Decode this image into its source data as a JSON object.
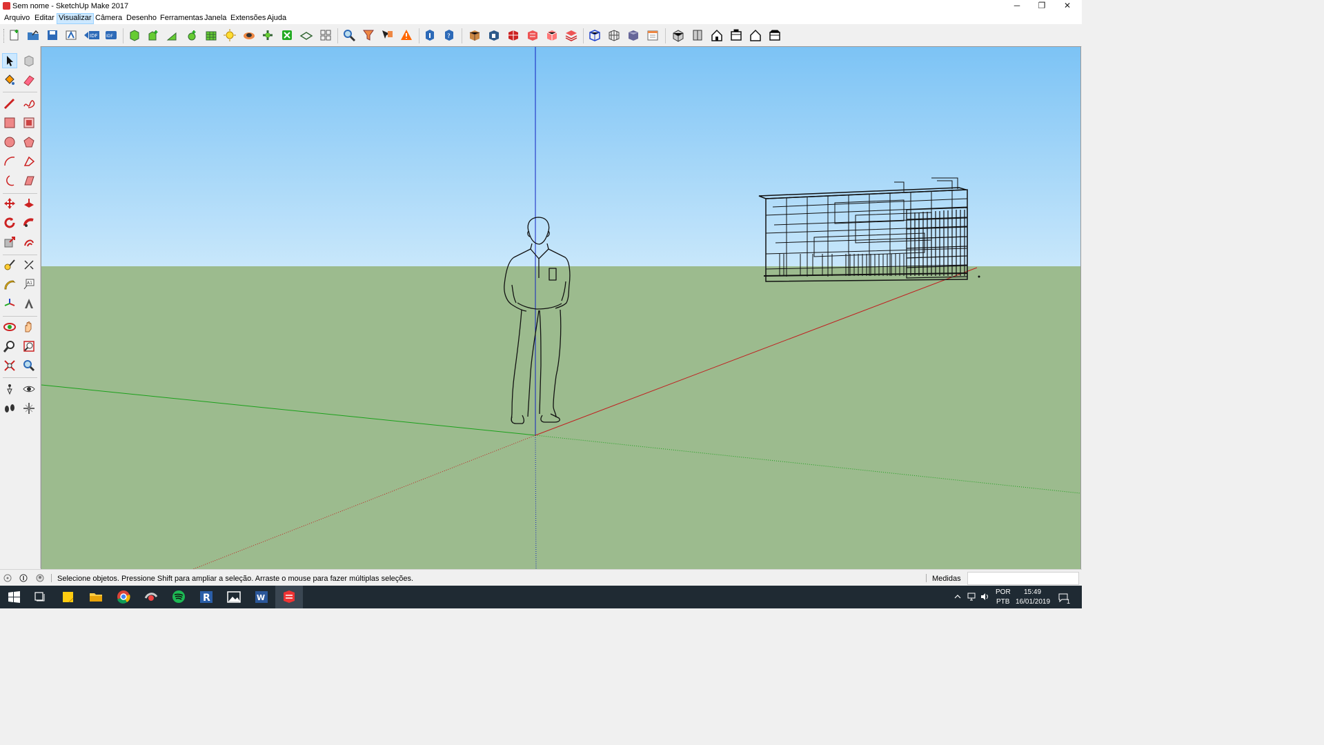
{
  "window": {
    "title": "Sem nome - SketchUp Make 2017",
    "minimize_glyph": "─",
    "restore_glyph": "❐",
    "close_glyph": "✕"
  },
  "menu": {
    "items": [
      "Arquivo",
      "Editar",
      "Visualizar",
      "Câmera",
      "Desenho",
      "Ferramentas",
      "Janela",
      "Extensões",
      "Ajuda"
    ],
    "active": "Visualizar"
  },
  "status": {
    "message": "Selecione objetos. Pressione Shift para ampliar a seleção. Arraste o mouse para fazer múltiplas seleções.",
    "measurements_label": "Medidas",
    "measurements_value": ""
  },
  "tray": {
    "language": "POR",
    "layout": "PTB",
    "time": "15:49",
    "date": "16/01/2019",
    "notification_count": "1"
  },
  "colors": {
    "sky_top": "#7cc3f5",
    "ground": "#9cbb8e",
    "axis_red": "#c02020",
    "axis_green": "#1aa01a",
    "axis_blue": "#1020c0",
    "taskbar": "#1f2a33"
  }
}
